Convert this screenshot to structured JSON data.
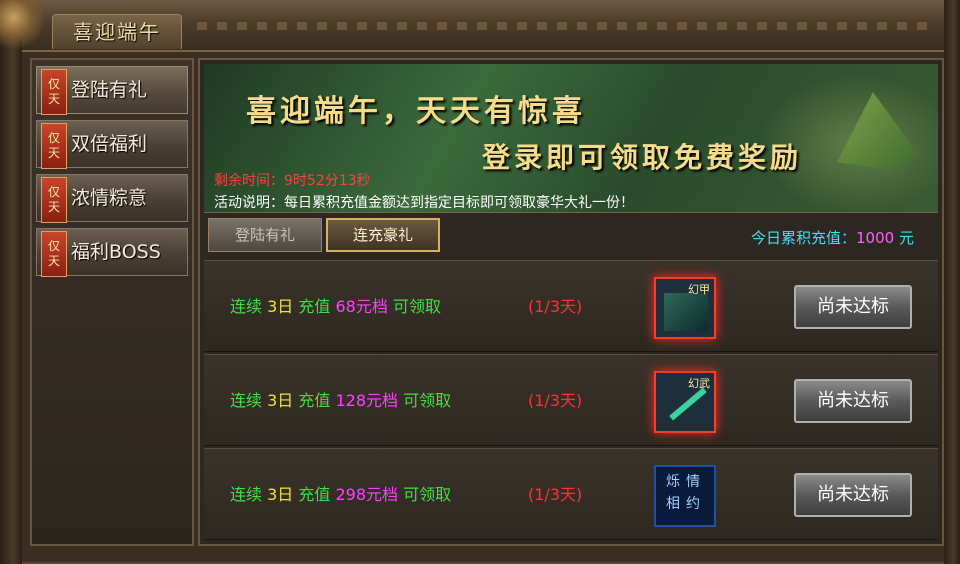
{
  "window": {
    "title": "喜迎端午"
  },
  "sidebar": {
    "items": [
      {
        "badge_top": "仅",
        "badge_bottom": "天",
        "label": "登陆有礼"
      },
      {
        "badge_top": "仅",
        "badge_bottom": "天",
        "label": "双倍福利"
      },
      {
        "badge_top": "仅",
        "badge_bottom": "天",
        "label": "浓情粽意"
      },
      {
        "badge_top": "仅",
        "badge_bottom": "天",
        "label": "福利BOSS"
      }
    ]
  },
  "banner": {
    "title": "喜迎端午，天天有惊喜",
    "subtitle": "登录即可领取免费奖励",
    "time_label": "剩余时间：",
    "time_value": "9时52分13秒",
    "desc_label": "活动说明：",
    "desc_value": "每日累积充值金额达到指定目标即可领取豪华大礼一份！"
  },
  "tabs": [
    {
      "label": "登陆有礼"
    },
    {
      "label": "连充豪礼"
    }
  ],
  "today_total": {
    "label": "今日累积充值：",
    "amount": "1000",
    "unit": "元"
  },
  "rewards": [
    {
      "prefix": "连续",
      "days": "3日",
      "mid": "充值",
      "tier": "68元档",
      "suffix": "可领取",
      "progress": "(1/3天)",
      "item_tag": "幻甲",
      "button": "尚未达标"
    },
    {
      "prefix": "连续",
      "days": "3日",
      "mid": "充值",
      "tier": "128元档",
      "suffix": "可领取",
      "progress": "(1/3天)",
      "item_tag": "幻武",
      "button": "尚未达标"
    },
    {
      "prefix": "连续",
      "days": "3日",
      "mid": "充值",
      "tier": "298元档",
      "suffix": "可领取",
      "progress": "(1/3天)",
      "item_tag": "烁情相约",
      "button": "尚未达标"
    }
  ],
  "colors": {
    "accent_gold": "#f6dc8a",
    "time_red": "#ff4040",
    "total_cyan": "#40e0f0",
    "amount_magenta": "#ff60ff"
  }
}
